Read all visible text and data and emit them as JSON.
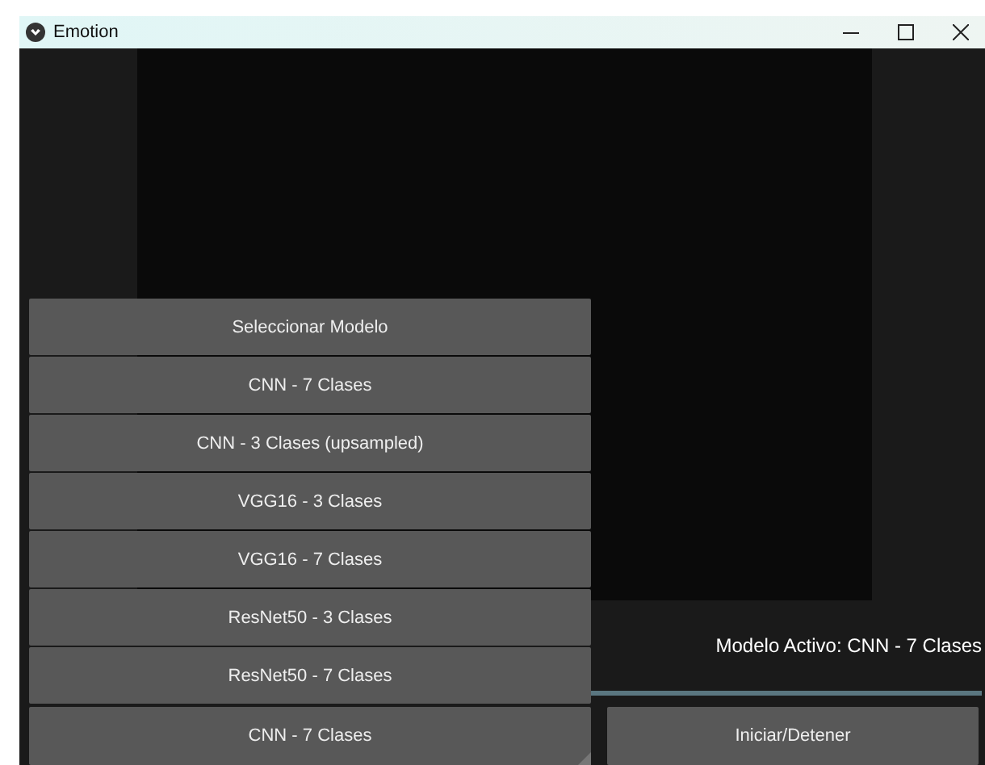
{
  "window": {
    "title": "Emotion"
  },
  "dropdown": {
    "options": [
      "Seleccionar Modelo",
      "CNN - 7 Clases",
      "CNN - 3 Clases (upsampled)",
      "VGG16 - 3 Clases",
      "VGG16 - 7 Clases",
      "ResNet50 - 3 Clases",
      "ResNet50 - 7 Clases"
    ]
  },
  "active_model_label": "Modelo Activo: CNN - 7 Clases",
  "model_spinner": {
    "value": "CNN - 7 Clases"
  },
  "buttons": [
    "Iniciar/Detener"
  ]
}
